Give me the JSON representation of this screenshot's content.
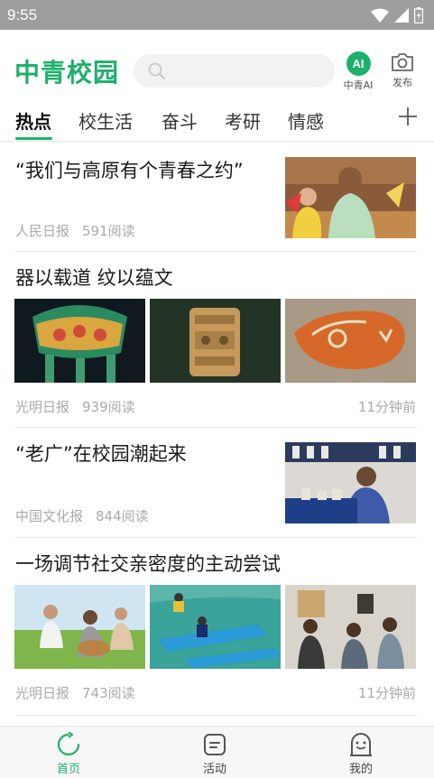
{
  "status": {
    "time": "9:55"
  },
  "header": {
    "logo": "中青校园",
    "ai_badge": "AI",
    "ai_label": "中青AI",
    "publish_label": "发布"
  },
  "tabs": [
    {
      "label": "热点",
      "active": true
    },
    {
      "label": "校生活"
    },
    {
      "label": "奋斗"
    },
    {
      "label": "考研"
    },
    {
      "label": "情感"
    }
  ],
  "articles": [
    {
      "title": "“我们与高原有个青春之约”",
      "source": "人民日报",
      "reads": "591阅读",
      "time": ""
    },
    {
      "title": "器以载道 纹以蕴文",
      "source": "光明日报",
      "reads": "939阅读",
      "time": "11分钟前"
    },
    {
      "title": "“老广”在校园潮起来",
      "source": "中国文化报",
      "reads": "844阅读",
      "time": ""
    },
    {
      "title": "一场调节社交亲密度的主动尝试",
      "source": "光明日报",
      "reads": "743阅读",
      "time": "11分钟前"
    }
  ],
  "bottom_nav": [
    {
      "label": "首页",
      "icon": "refresh-icon",
      "active": true
    },
    {
      "label": "活动",
      "icon": "activity-icon"
    },
    {
      "label": "我的",
      "icon": "profile-icon"
    }
  ],
  "colors": {
    "brand": "#1db16b",
    "status_bar": "#9e9e9e"
  }
}
